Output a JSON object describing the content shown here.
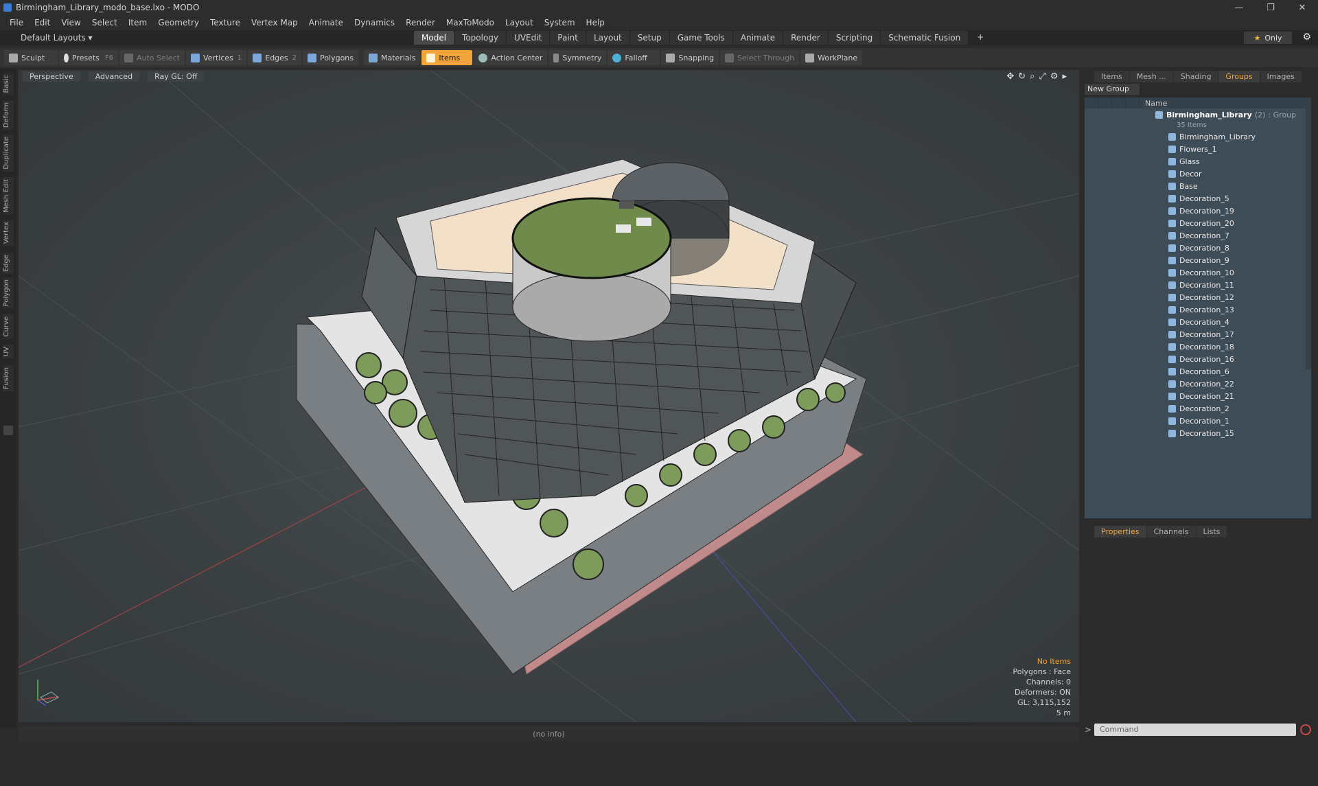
{
  "window": {
    "title": "Birmingham_Library_modo_base.lxo - MODO",
    "minimize": "—",
    "restore": "❐",
    "close": "✕"
  },
  "menu": [
    "File",
    "Edit",
    "View",
    "Select",
    "Item",
    "Geometry",
    "Texture",
    "Vertex Map",
    "Animate",
    "Dynamics",
    "Render",
    "MaxToModo",
    "Layout",
    "System",
    "Help"
  ],
  "layout": {
    "selector": "Default Layouts ▾",
    "tabs": [
      "Model",
      "Topology",
      "UVEdit",
      "Paint",
      "Layout",
      "Setup",
      "Game Tools",
      "Animate",
      "Render",
      "Scripting",
      "Schematic Fusion"
    ],
    "active_tab": "Model",
    "plus": "+",
    "only": "Only",
    "gear": "⚙"
  },
  "toolbar": {
    "sculpt": "Sculpt",
    "presets": "Presets",
    "presets_key": "F6",
    "auto_select": "Auto Select",
    "vertices": "Vertices",
    "vertices_num": "1",
    "edges": "Edges",
    "edges_num": "2",
    "polygons": "Polygons",
    "materials": "Materials",
    "items": "Items",
    "action_center": "Action Center",
    "symmetry": "Symmetry",
    "falloff": "Falloff",
    "snapping": "Snapping",
    "select_through": "Select Through",
    "workplane": "WorkPlane"
  },
  "sidebar_tabs": [
    "Basic",
    "Deform",
    "Duplicate",
    "Mesh Edit",
    "Vertex",
    "Edge",
    "Polygon",
    "Curve",
    "UV",
    "Fusion"
  ],
  "viewport": {
    "view": "Perspective",
    "shading": "Advanced",
    "raygl": "Ray GL: Off",
    "info": {
      "selection": "No Items",
      "polygons": "Polygons : Face",
      "channels": "Channels: 0",
      "deformers": "Deformers: ON",
      "gl": "GL: 3,115,152",
      "scale": "5 m"
    }
  },
  "right_panel": {
    "tabs": [
      "Items",
      "Mesh ...",
      "Shading",
      "Groups",
      "Images"
    ],
    "active_tab": "Groups",
    "new_group": "New Group",
    "name_header": "Name",
    "group": {
      "name": "Birmingham_Library",
      "count": "(2)",
      "type": ": Group",
      "items_count": "35 Items"
    },
    "items": [
      "Birmingham_Library",
      "Flowers_1",
      "Glass",
      "Decor",
      "Base",
      "Decoration_5",
      "Decoration_19",
      "Decoration_20",
      "Decoration_7",
      "Decoration_8",
      "Decoration_9",
      "Decoration_10",
      "Decoration_11",
      "Decoration_12",
      "Decoration_13",
      "Decoration_4",
      "Decoration_17",
      "Decoration_18",
      "Decoration_16",
      "Decoration_6",
      "Decoration_22",
      "Decoration_21",
      "Decoration_2",
      "Decoration_1",
      "Decoration_15"
    ],
    "props_tabs": [
      "Properties",
      "Channels",
      "Lists"
    ],
    "props_active": "Properties"
  },
  "status": {
    "info": "(no info)"
  },
  "command": {
    "placeholder": "Command"
  },
  "colors": {
    "accent": "#f0a43a",
    "viewport_bg": "#3d4245",
    "group_bg": "#3e4c57"
  }
}
